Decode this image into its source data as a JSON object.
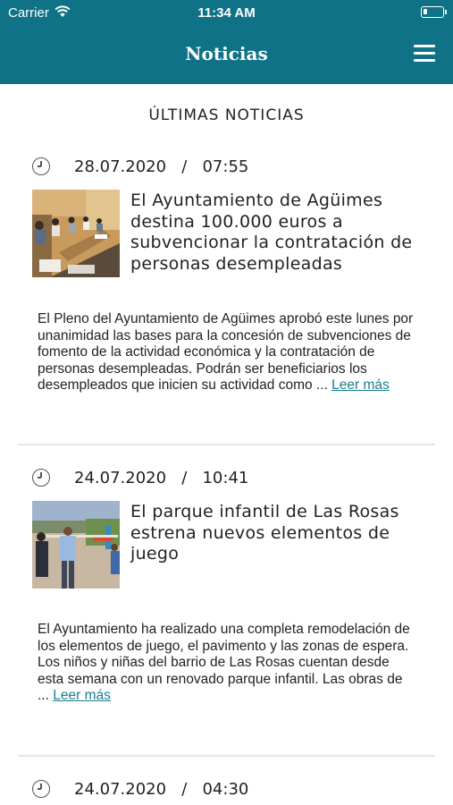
{
  "status_bar": {
    "carrier": "Carrier",
    "time": "11:34 AM"
  },
  "nav": {
    "title": "Noticias",
    "menu_icon": "hamburger-menu-icon"
  },
  "section_title": "ÚLTIMAS NOTICIAS",
  "colors": {
    "accent": "#0f7286",
    "link": "#1a7e93",
    "divider": "#e6e6e6"
  },
  "articles": [
    {
      "date": "28.07.2020",
      "separator": "/",
      "time": "07:55",
      "headline": "El Ayuntamiento de Agüimes destina 100.000 euros a subvencionar la contratación de personas desempleadas",
      "summary": "El Pleno del Ayuntamiento de Agüimes aprobó este lunes por unanimidad las bases para la concesión de subvenciones de fomento de la actividad económica y la contratación de personas desempleadas. Podrán ser beneficiarios los desempleados que inicien su actividad como ...",
      "read_more": "Leer más",
      "image_icon": "meeting-room-photo"
    },
    {
      "date": "24.07.2020",
      "separator": "/",
      "time": "10:41",
      "headline": "El parque infantil de Las Rosas estrena nuevos elementos de juego",
      "summary": "El Ayuntamiento ha realizado una completa remodelación de los elementos de juego, el pavimento y las zonas de espera. Los niños y niñas del barrio de Las Rosas cuentan desde esta semana con un renovado parque infantil. Las obras de ...",
      "read_more": "Leer más",
      "image_icon": "playground-photo"
    },
    {
      "date": "24.07.2020",
      "separator": "/",
      "time": "04:30"
    }
  ]
}
